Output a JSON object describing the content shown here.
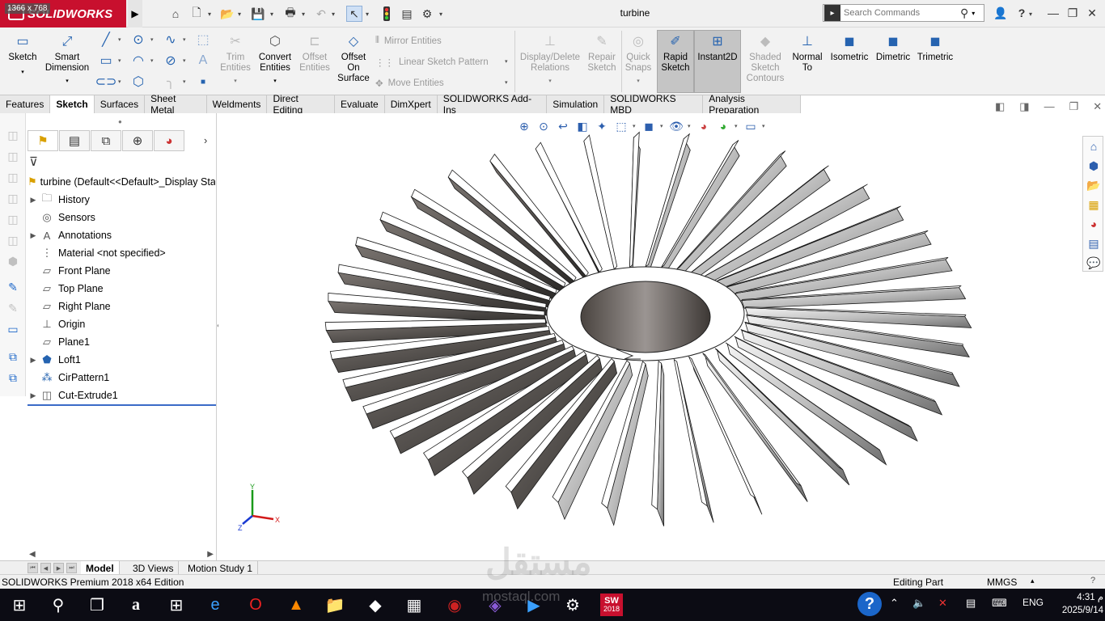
{
  "window": {
    "brand": "SOLIDWORKS",
    "dimension_badge": "1366 x 768",
    "document_title": "turbine",
    "search_placeholder": "Search Commands"
  },
  "command_manager": {
    "sketch": "Sketch",
    "smart_dimension": "Smart Dimension",
    "trim_entities": "Trim Entities",
    "convert_entities": "Convert Entities",
    "offset_entities": "Offset Entities",
    "offset_on_surface": "Offset On Surface",
    "mirror_entities": "Mirror Entities",
    "linear_sketch_pattern": "Linear Sketch Pattern",
    "move_entities": "Move Entities",
    "display_delete_relations": "Display/Delete Relations",
    "repair_sketch": "Repair Sketch",
    "quick_snaps": "Quick Snaps",
    "rapid_sketch": "Rapid Sketch",
    "instant2d": "Instant2D",
    "shaded_sketch_contours": "Shaded Sketch Contours",
    "normal_to": "Normal To",
    "isometric": "Isometric",
    "dimetric": "Dimetric",
    "trimetric": "Trimetric"
  },
  "tabs": [
    "Features",
    "Sketch",
    "Surfaces",
    "Sheet Metal",
    "Weldments",
    "Direct Editing",
    "Evaluate",
    "DimXpert",
    "SOLIDWORKS Add-Ins",
    "Simulation",
    "SOLIDWORKS MBD",
    "Analysis Preparation"
  ],
  "feature_tree": {
    "root": "turbine  (Default<<Default>_Display Sta",
    "items": [
      {
        "label": "History",
        "icon": "history-folder-icon",
        "expandable": true
      },
      {
        "label": "Sensors",
        "icon": "sensors-icon",
        "expandable": false
      },
      {
        "label": "Annotations",
        "icon": "annotations-icon",
        "expandable": true
      },
      {
        "label": "Material <not specified>",
        "icon": "material-icon",
        "expandable": false
      },
      {
        "label": "Front Plane",
        "icon": "plane-icon",
        "expandable": false
      },
      {
        "label": "Top Plane",
        "icon": "plane-icon",
        "expandable": false
      },
      {
        "label": "Right Plane",
        "icon": "plane-icon",
        "expandable": false
      },
      {
        "label": "Origin",
        "icon": "origin-icon",
        "expandable": false
      },
      {
        "label": "Plane1",
        "icon": "plane-icon",
        "expandable": false
      },
      {
        "label": "Loft1",
        "icon": "loft-icon",
        "expandable": true
      },
      {
        "label": "CirPattern1",
        "icon": "circular-pattern-icon",
        "expandable": false
      },
      {
        "label": "Cut-Extrude1",
        "icon": "cut-extrude-icon",
        "expandable": true
      }
    ]
  },
  "bottom_tabs": [
    "Model",
    "3D Views",
    "Motion Study 1"
  ],
  "status_bar": {
    "edition": "SOLIDWORKS Premium 2018 x64 Edition",
    "mode": "Editing Part",
    "units": "MMGS"
  },
  "triad": {
    "x": "X",
    "y": "Y",
    "z": "Z"
  },
  "taskbar": {
    "language": "ENG",
    "time": "4:31 م",
    "date": "2025/9/14",
    "solidworks_badge": "2018"
  },
  "watermark": {
    "arabic": "مستقل",
    "latin": "mostaql.com"
  },
  "colors": {
    "brand_red": "#c8102e",
    "accent_blue": "#1b66c9",
    "taskbar": "#0c0c14"
  }
}
